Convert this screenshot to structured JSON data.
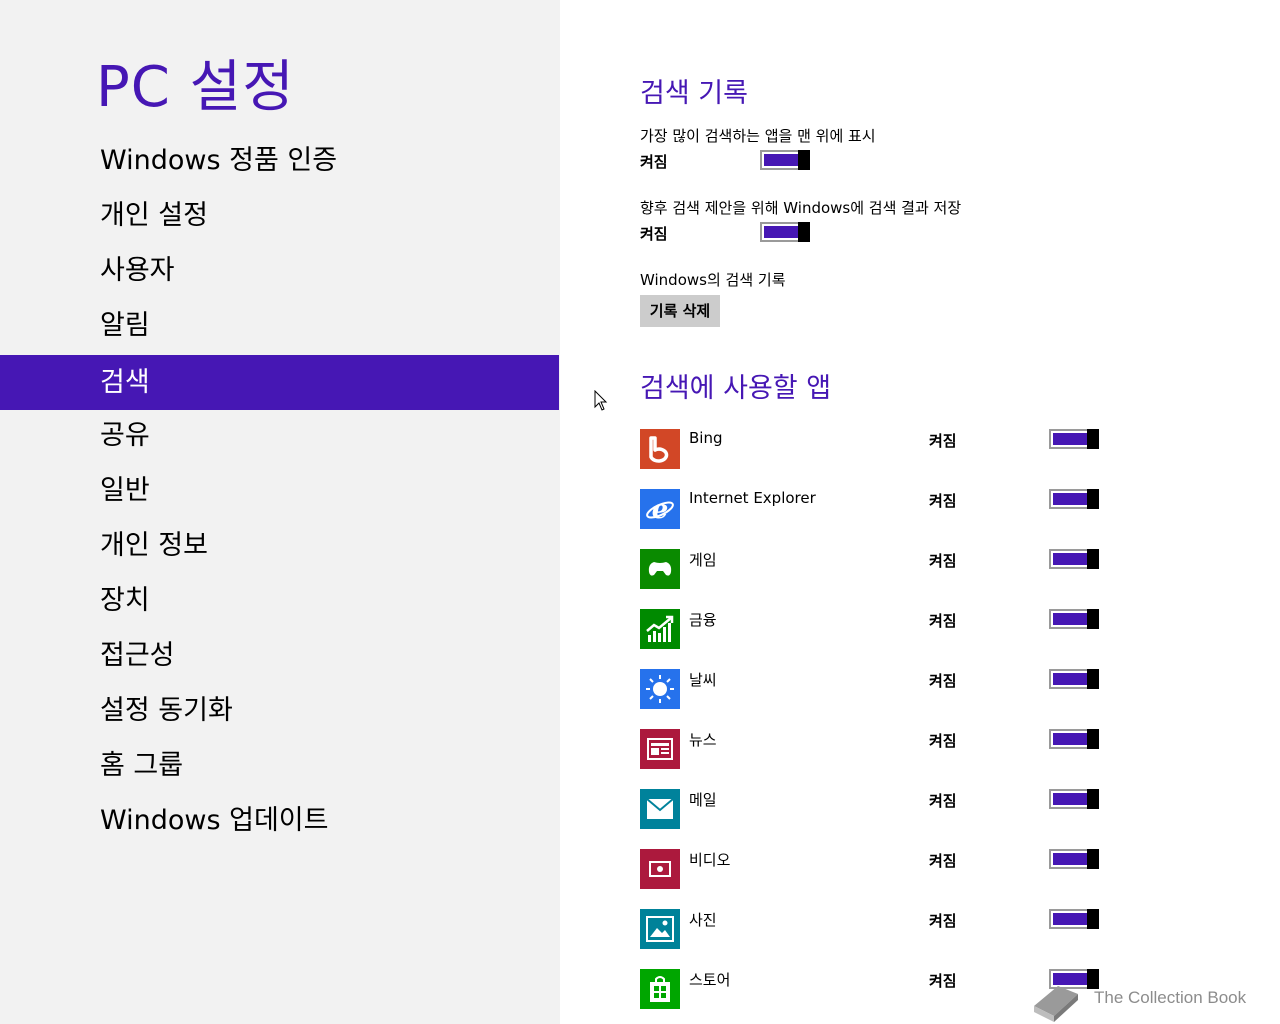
{
  "sidebar": {
    "title": "PC 설정",
    "items": [
      {
        "label": "Windows 정품 인증"
      },
      {
        "label": "개인 설정"
      },
      {
        "label": "사용자"
      },
      {
        "label": "알림"
      },
      {
        "label": "검색",
        "selected": true
      },
      {
        "label": "공유"
      },
      {
        "label": "일반"
      },
      {
        "label": "개인 정보"
      },
      {
        "label": "장치"
      },
      {
        "label": "접근성"
      },
      {
        "label": "설정 동기화"
      },
      {
        "label": "홈 그룹"
      },
      {
        "label": "Windows 업데이트"
      }
    ]
  },
  "search_history": {
    "title": "검색 기록",
    "setting1": {
      "label": "가장 많이 검색하는 앱을 맨 위에 표시",
      "state": "켜짐",
      "on": true
    },
    "setting2": {
      "label": "향후 검색 제안을 위해 Windows에 검색 결과 저장",
      "state": "켜짐",
      "on": true
    },
    "history_label": "Windows의 검색 기록",
    "clear_button": "기록 삭제"
  },
  "search_apps": {
    "title": "검색에 사용할 앱",
    "apps": [
      {
        "name": "Bing",
        "state": "켜짐",
        "on": true,
        "icon": "bing-icon",
        "color": "#d24726"
      },
      {
        "name": "Internet Explorer",
        "state": "켜짐",
        "on": true,
        "icon": "internet-explorer-icon",
        "color": "#2672ec"
      },
      {
        "name": "게임",
        "state": "켜짐",
        "on": true,
        "icon": "games-controller-icon",
        "color": "#0a8a00"
      },
      {
        "name": "금융",
        "state": "켜짐",
        "on": true,
        "icon": "finance-chart-icon",
        "color": "#008a00"
      },
      {
        "name": "날씨",
        "state": "켜짐",
        "on": true,
        "icon": "weather-sun-icon",
        "color": "#2672ec"
      },
      {
        "name": "뉴스",
        "state": "켜짐",
        "on": true,
        "icon": "news-icon",
        "color": "#ac193d"
      },
      {
        "name": "메일",
        "state": "켜짐",
        "on": true,
        "icon": "mail-envelope-icon",
        "color": "#00829b"
      },
      {
        "name": "비디오",
        "state": "켜짐",
        "on": true,
        "icon": "video-icon",
        "color": "#ac193d"
      },
      {
        "name": "사진",
        "state": "켜짐",
        "on": true,
        "icon": "photos-icon",
        "color": "#008299"
      },
      {
        "name": "스토어",
        "state": "켜짐",
        "on": true,
        "icon": "store-bag-icon",
        "color": "#00a600"
      }
    ]
  },
  "watermark": {
    "text": "The Collection Book",
    "icon": "book-icon"
  },
  "colors": {
    "accent": "#4617b4",
    "sidebar_bg": "#f2f2f2"
  }
}
